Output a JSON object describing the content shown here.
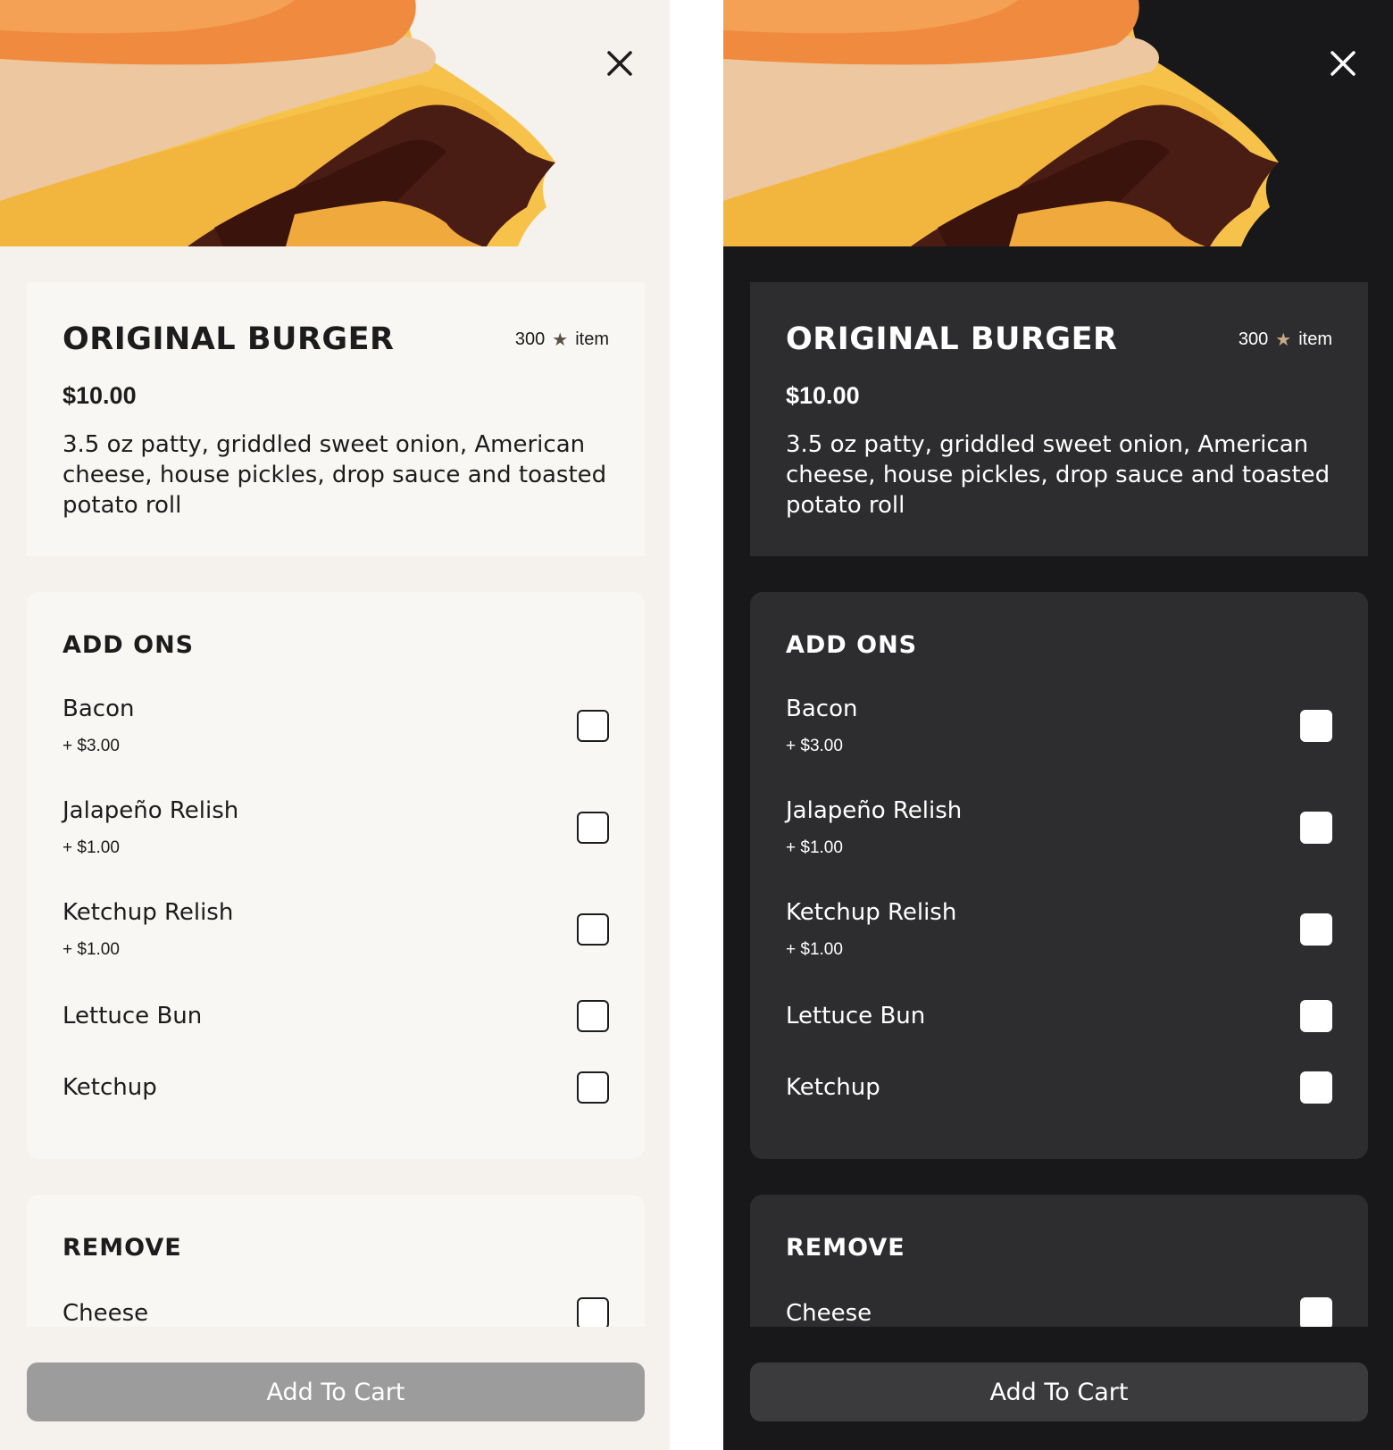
{
  "colors": {
    "light_background": "#f5f1ed",
    "light_card": "#f9f7f4",
    "dark_background": "#18181a",
    "dark_card": "#2d2d2f",
    "light_add_button": "#9c9c9c",
    "dark_add_button": "#3b3b3d"
  },
  "icons": {
    "close": "close-icon",
    "star": "star-icon"
  },
  "light": {
    "product": {
      "title": "ORIGINAL BURGER",
      "rating_count": "300",
      "rating_unit": "item",
      "price": "$10.00",
      "description": "3.5 oz patty, griddled sweet onion, American cheese, house pickles, drop sauce and toasted potato roll"
    },
    "add_ons": {
      "heading": "ADD ONS",
      "items": [
        {
          "name": "Bacon",
          "price": "+ $3.00"
        },
        {
          "name": "Jalapeño Relish",
          "price": "+ $1.00"
        },
        {
          "name": "Ketchup Relish",
          "price": "+ $1.00"
        },
        {
          "name": "Lettuce Bun"
        },
        {
          "name": "Ketchup"
        }
      ]
    },
    "remove": {
      "heading": "REMOVE",
      "items": [
        {
          "name": "Cheese"
        }
      ]
    },
    "add_to_cart_label": "Add To Cart"
  },
  "dark": {
    "product": {
      "title": "ORIGINAL BURGER",
      "rating_count": "300",
      "rating_unit": "item",
      "price": "$10.00",
      "description": "3.5 oz patty, griddled sweet onion, American cheese, house pickles, drop sauce and toasted potato roll"
    },
    "add_ons": {
      "heading": "ADD ONS",
      "items": [
        {
          "name": "Bacon",
          "price": "+ $3.00"
        },
        {
          "name": "Jalapeño Relish",
          "price": "+ $1.00"
        },
        {
          "name": "Ketchup Relish",
          "price": "+ $1.00"
        },
        {
          "name": "Lettuce Bun"
        },
        {
          "name": "Ketchup"
        }
      ]
    },
    "remove": {
      "heading": "REMOVE",
      "items": [
        {
          "name": "Cheese"
        }
      ]
    },
    "add_to_cart_label": "Add To Cart"
  }
}
